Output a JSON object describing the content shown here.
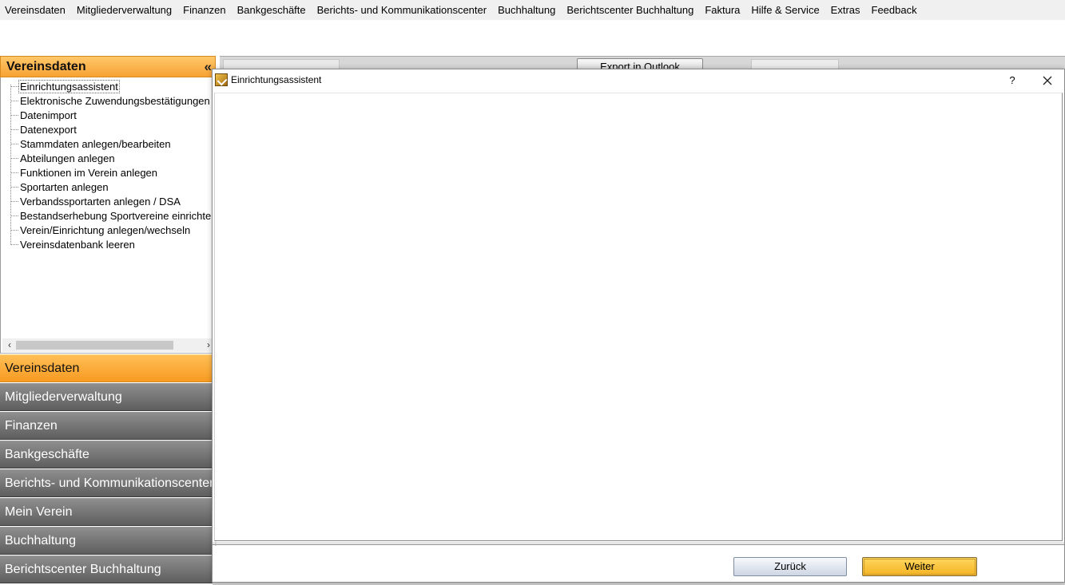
{
  "menubar": {
    "items": [
      "Vereinsdaten",
      "Mitgliederverwaltung",
      "Finanzen",
      "Bankgeschäfte",
      "Berichts- und Kommunikationscenter",
      "Buchhaltung",
      "Berichtscenter Buchhaltung",
      "Faktura",
      "Hilfe & Service",
      "Extras",
      "Feedback"
    ]
  },
  "nav": {
    "header_title": "Vereinsdaten",
    "collapse_glyph": "«",
    "tree_items": [
      "Einrichtungsassistent",
      "Elektronische Zuwendungsbestätigungen",
      "Datenimport",
      "Datenexport",
      "Stammdaten anlegen/bearbeiten",
      "Abteilungen anlegen",
      "Funktionen im Verein anlegen",
      "Sportarten anlegen",
      "Verbandssportarten anlegen / DSA",
      "Bestandserhebung Sportvereine einrichten",
      "Verein/Einrichtung anlegen/wechseln",
      "Vereinsdatenbank leeren"
    ],
    "selected_item": "Einrichtungsassistent",
    "categories": [
      "Vereinsdaten",
      "Mitgliederverwaltung",
      "Finanzen",
      "Bankgeschäfte",
      "Berichts- und Kommunikationscenter",
      "Mein Verein",
      "Buchhaltung",
      "Berichtscenter Buchhaltung"
    ],
    "active_category": "Vereinsdaten"
  },
  "background": {
    "export_button": "Export in Outlook"
  },
  "dialog": {
    "title": "Einrichtungsassistent",
    "help_glyph": "?",
    "back_label": "Zurück",
    "next_label": "Weiter"
  },
  "colors": {
    "accent_orange": "#f7a233",
    "category_gray": "#6e6e6e",
    "next_button_yellow": "#ffc83d"
  }
}
